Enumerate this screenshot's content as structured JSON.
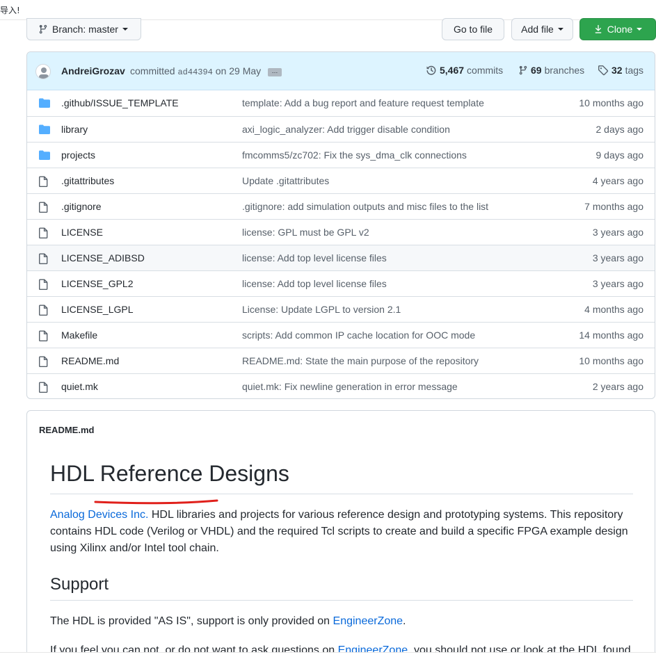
{
  "top_note": "导入!",
  "toolbar": {
    "branch_label": "Branch: master",
    "goto_label": "Go to file",
    "addfile_label": "Add file",
    "clone_label": "Clone"
  },
  "commit": {
    "author": "AndreiGrozav",
    "action": "committed",
    "hash": "ad44394",
    "date": "on 29 May",
    "commits_count": "5,467",
    "commits_label": "commits",
    "branches_count": "69",
    "branches_label": "branches",
    "tags_count": "32",
    "tags_label": "tags"
  },
  "files": [
    {
      "type": "folder",
      "name": ".github/ISSUE_TEMPLATE",
      "message": "template: Add a bug report and feature request template",
      "age": "10 months ago"
    },
    {
      "type": "folder",
      "name": "library",
      "message": "axi_logic_analyzer: Add trigger disable condition",
      "age": "2 days ago"
    },
    {
      "type": "folder",
      "name": "projects",
      "message": "fmcomms5/zc702: Fix the sys_dma_clk connections",
      "age": "9 days ago"
    },
    {
      "type": "file",
      "name": ".gitattributes",
      "message": "Update .gitattributes",
      "age": "4 years ago"
    },
    {
      "type": "file",
      "name": ".gitignore",
      "message": ".gitignore: add simulation outputs and misc files to the list",
      "age": "7 months ago"
    },
    {
      "type": "file",
      "name": "LICENSE",
      "message": "license: GPL must be GPL v2",
      "age": "3 years ago"
    },
    {
      "type": "file",
      "name": "LICENSE_ADIBSD",
      "message": "license: Add top level license files",
      "age": "3 years ago"
    },
    {
      "type": "file",
      "name": "LICENSE_GPL2",
      "message": "license: Add top level license files",
      "age": "3 years ago"
    },
    {
      "type": "file",
      "name": "LICENSE_LGPL",
      "message": "License: Update LGPL to version 2.1",
      "age": "4 months ago"
    },
    {
      "type": "file",
      "name": "Makefile",
      "message": "scripts: Add common IP cache location for OOC mode",
      "age": "14 months ago"
    },
    {
      "type": "file",
      "name": "README.md",
      "message": "README.md: State the main purpose of the repository",
      "age": "10 months ago"
    },
    {
      "type": "file",
      "name": "quiet.mk",
      "message": "quiet.mk: Fix newline generation in error message",
      "age": "2 years ago"
    }
  ],
  "readme": {
    "header": "README.md",
    "title": "HDL Reference Designs",
    "intro_link": "Analog Devices Inc.",
    "intro_text": " HDL libraries and projects for various reference design and prototyping systems. This repository contains HDL code (Verilog or VHDL) and the required Tcl scripts to create and build a specific FPGA example design using Xilinx and/or Intel tool chain.",
    "support_title": "Support",
    "support_p1_prefix": "The HDL is provided \"AS IS\", support is only provided on ",
    "support_p1_link": "EngineerZone",
    "support_p1_suffix": ".",
    "support_p2_prefix": "If you feel you can not, or do not want to ask questions on ",
    "support_p2_link": "EngineerZone",
    "support_p2_suffix": ", you should not use or look at the HDL found in"
  },
  "colors": {
    "accent_link": "#0969da",
    "commit_bar": "#ddf4ff",
    "clone_green": "#2da44e",
    "folder_blue": "#54aeff",
    "annotation_red": "#e0201b"
  }
}
